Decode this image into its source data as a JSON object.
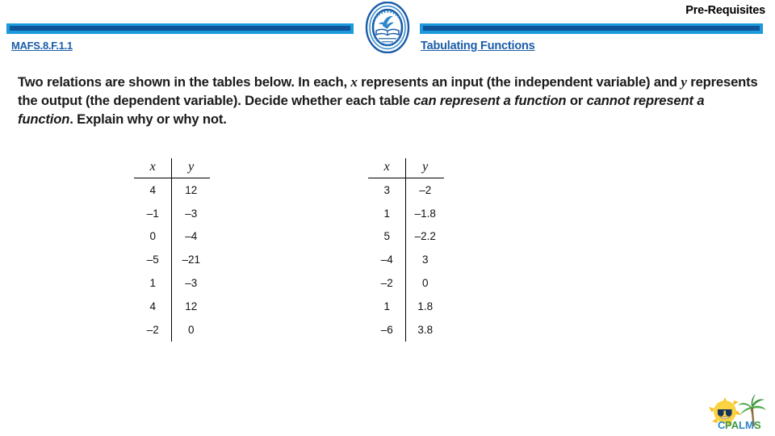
{
  "header": {
    "pre_requisites_label": "Pre-Requisites",
    "standard_code": "MAFS.8.F.1.1",
    "lesson_title": "Tabulating Functions",
    "logo_name": "school-seal-logo",
    "accent_light_blue": "#1B9BDC",
    "accent_dark_blue": "#10559A",
    "link_blue": "#1B5DA8"
  },
  "prompt": {
    "part1": "Two relations are shown in the tables below. In each, ",
    "var_x": "x",
    "part2": " represents an input (the independent variable) and ",
    "var_y": "y",
    "part3": " represents the output (the dependent variable). Decide whether each table ",
    "italic1": "can represent a function",
    "part4": " or ",
    "italic2": "cannot represent a function",
    "part5": ". Explain why or why not."
  },
  "tables": [
    {
      "name": "relation-table-1",
      "headers": [
        "x",
        "y"
      ],
      "rows": [
        [
          "4",
          "12"
        ],
        [
          "–1",
          "–3"
        ],
        [
          "0",
          "–4"
        ],
        [
          "–5",
          "–21"
        ],
        [
          "1",
          "–3"
        ],
        [
          "4",
          "12"
        ],
        [
          "–2",
          "0"
        ]
      ]
    },
    {
      "name": "relation-table-2",
      "headers": [
        "x",
        "y"
      ],
      "rows": [
        [
          "3",
          "–2"
        ],
        [
          "1",
          "–1.8"
        ],
        [
          "5",
          "–2.2"
        ],
        [
          "–4",
          "3"
        ],
        [
          "–2",
          "0"
        ],
        [
          "1",
          "1.8"
        ],
        [
          "–6",
          "3.8"
        ]
      ]
    }
  ],
  "footer": {
    "logo_text": "CPALMS",
    "logo_name": "cpalms-logo"
  }
}
